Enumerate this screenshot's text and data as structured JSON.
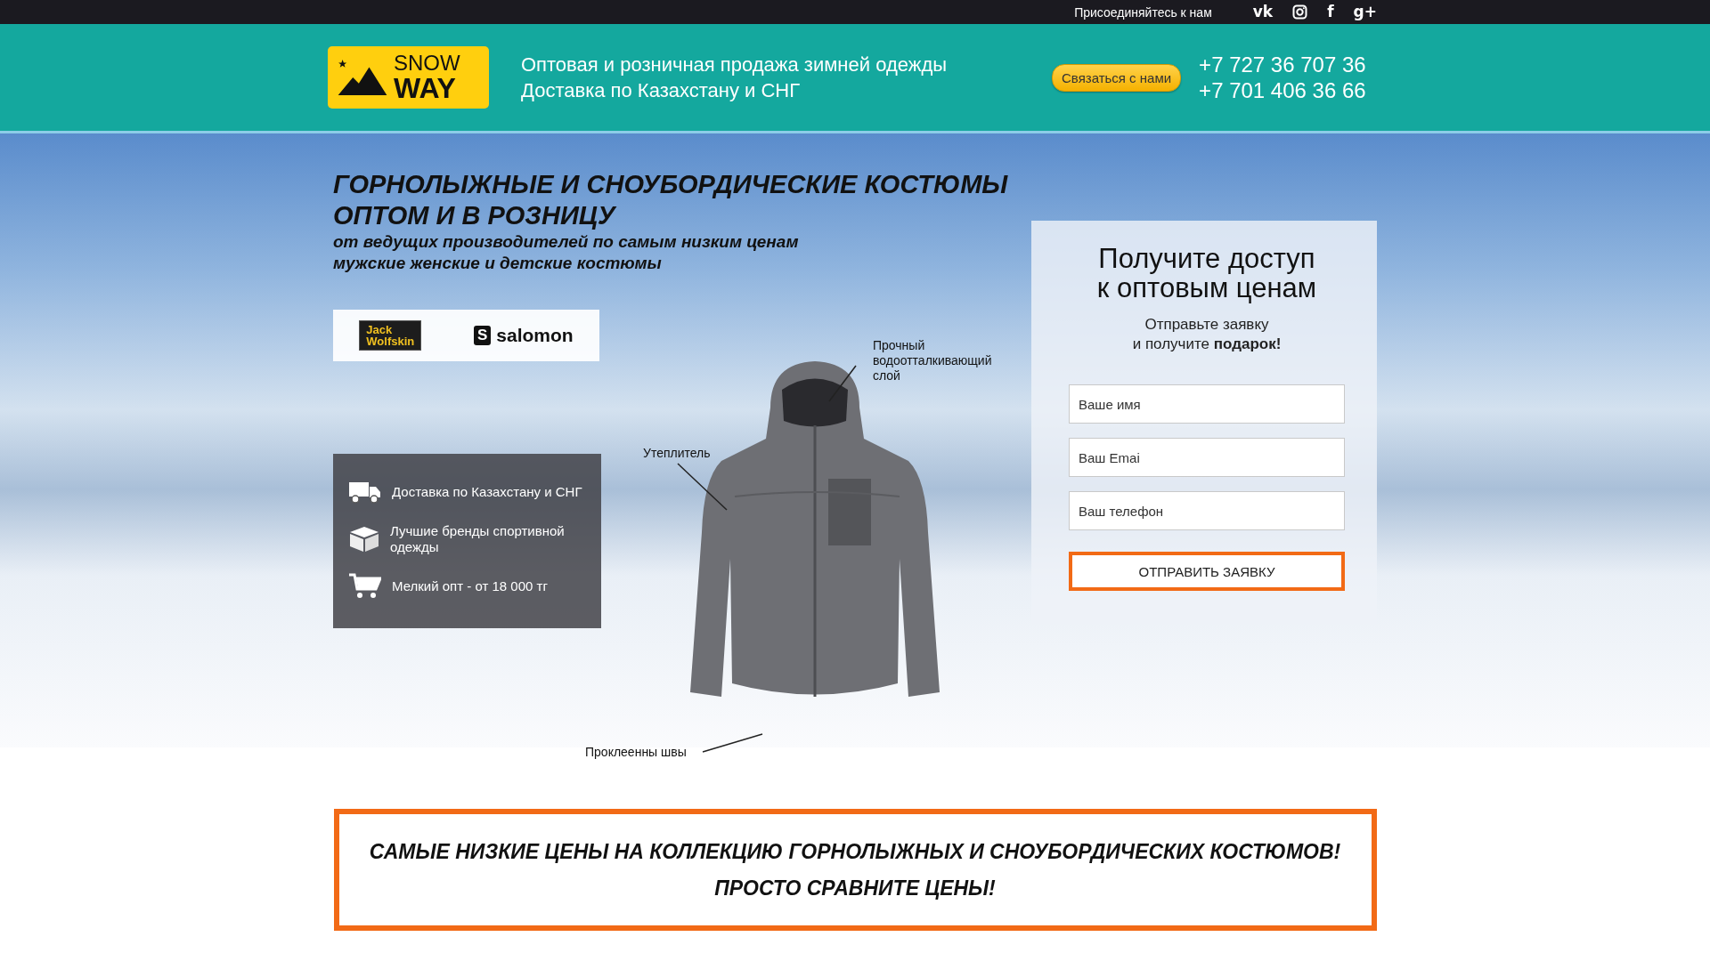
{
  "top_bar": {
    "join_text": "Присоединяйтесь к нам",
    "social": [
      {
        "kind": "text",
        "glyph": "vk"
      },
      {
        "kind": "instagram"
      },
      {
        "kind": "text",
        "glyph": "f"
      },
      {
        "kind": "text",
        "glyph": "g+"
      }
    ]
  },
  "header": {
    "logo": {
      "line1": "SNOW",
      "line2": "WAY"
    },
    "tagline": [
      "Оптовая и розничная продажа зимней одежды",
      "Доставка по Казахстану и СНГ"
    ],
    "contact_button": "Связаться с нами",
    "phones": [
      "+7 727 36 707 36",
      "+7 701 406 36 66"
    ]
  },
  "hero": {
    "title": [
      "ГОРНОЛЫЖНЫЕ И СНОУБОРДИЧЕСКИЕ КОСТЮМЫ",
      "ОПТОМ И В РОЗНИЦУ"
    ],
    "subtitle": [
      "от ведущих производителей по самым низким ценам",
      "мужские женские и детские костюмы"
    ],
    "brands": [
      {
        "kind": "jack",
        "lines": [
          "Jack",
          "Wolfskin"
        ]
      },
      {
        "kind": "salomon",
        "mark": "S",
        "name": "salomon"
      }
    ],
    "features": [
      {
        "kind": "truck",
        "text": "Доставка по Казахстану и СНГ"
      },
      {
        "kind": "box",
        "text": "Лучшие бренды спортивной одежды"
      },
      {
        "kind": "cart",
        "text": "Мелкий опт - от 18 000 тг"
      }
    ],
    "callouts": [
      {
        "lines": [
          "Прочный",
          "водоотталкивающий",
          "слой"
        ]
      },
      {
        "lines": [
          "Утеплитель"
        ]
      },
      {
        "lines": [
          "Проклеенны швы"
        ]
      }
    ],
    "form": {
      "title": [
        "Получите доступ",
        "к оптовым ценам"
      ],
      "note": [
        "Отправьте заявку",
        "и получите **подарок!**"
      ],
      "fields": [
        {
          "placeholder": "Ваше имя"
        },
        {
          "placeholder": "Ваш Emai"
        },
        {
          "placeholder": "Ваш телефон"
        }
      ],
      "submit": "ОТПРАВИТЬ ЗАЯВКУ"
    }
  },
  "banner": {
    "lines": [
      "САМЫЕ НИЗКИЕ ЦЕНЫ НА КОЛЛЕКЦИЮ ГОРНОЛЫЖНЫХ И СНОУБОРДИЧЕСКИХ КОСТЮМОВ!",
      "ПРОСТО СРАВНИТЕ ЦЕНЫ!"
    ]
  }
}
